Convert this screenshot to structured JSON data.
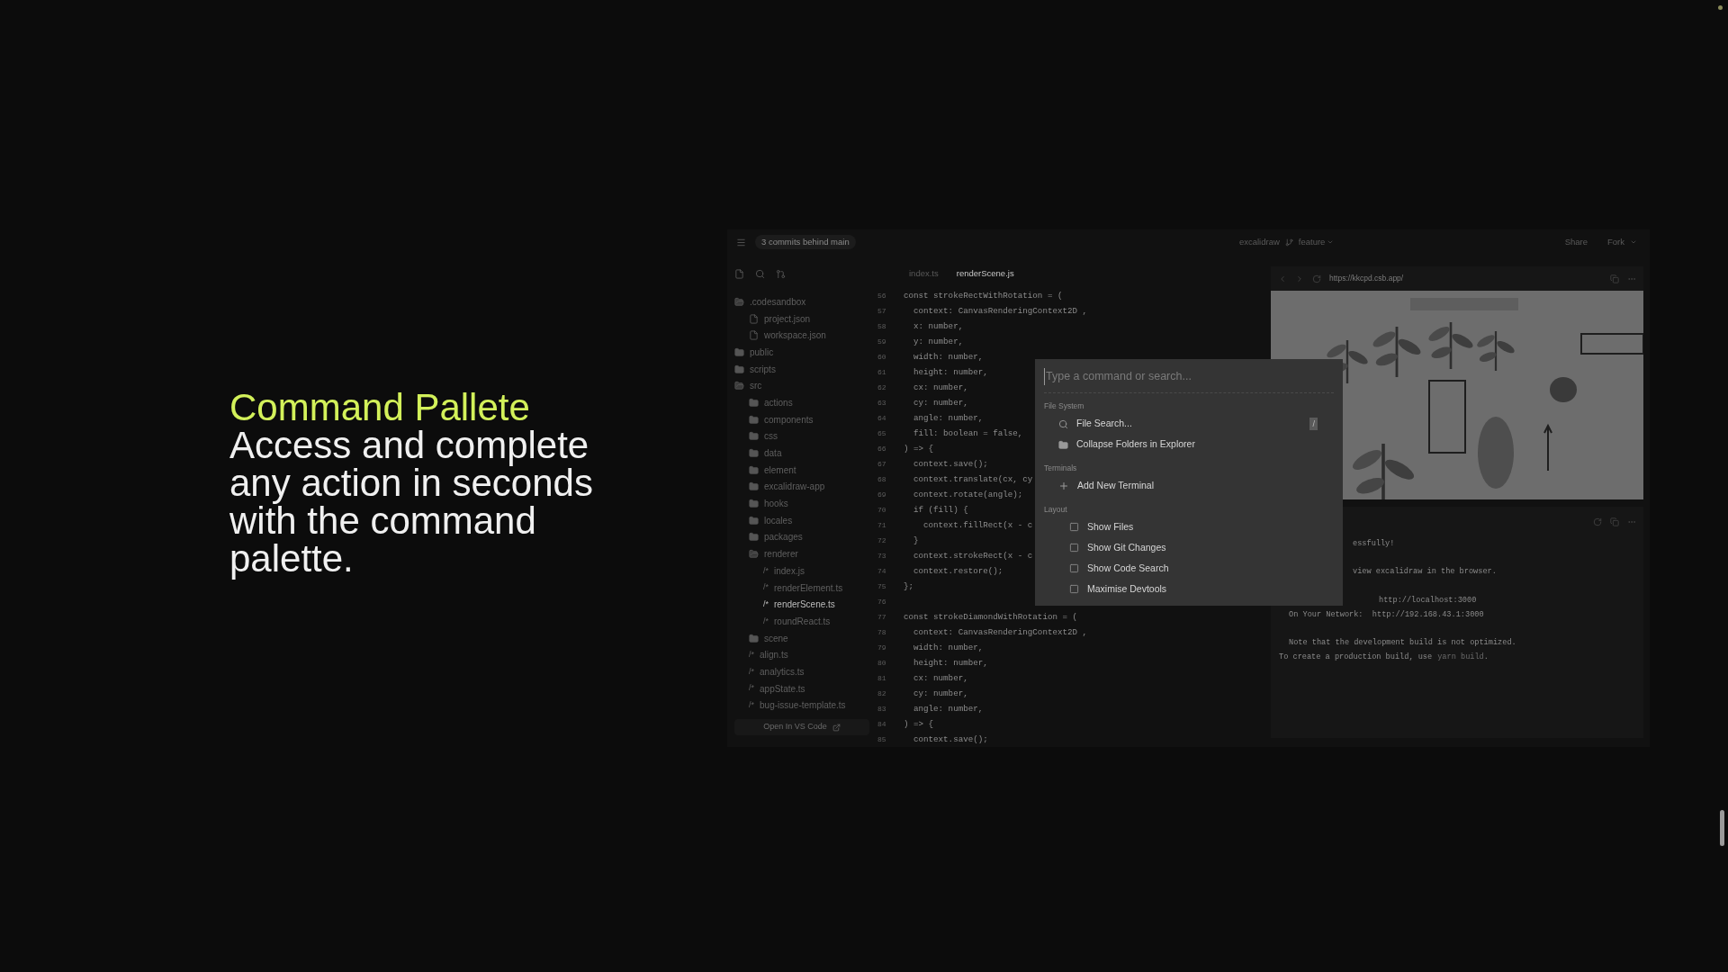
{
  "hero": {
    "title": "Command Pallete",
    "body": "Access and complete any action in seconds with the command palette."
  },
  "header": {
    "commits": "3 commits behind main",
    "project": "excalidraw",
    "branch": "feature",
    "share": "Share",
    "fork": "Fork"
  },
  "sidebar": {
    "tree": [
      {
        "name": ".codesandbox",
        "kind": "folder",
        "expanded": true,
        "selected": false,
        "children": [
          {
            "name": "project.json",
            "kind": "file",
            "selected": false
          },
          {
            "name": "workspace.json",
            "kind": "file",
            "selected": false
          }
        ]
      },
      {
        "name": "public",
        "kind": "folder",
        "expanded": false,
        "selected": false
      },
      {
        "name": "scripts",
        "kind": "folder",
        "expanded": false,
        "selected": false
      },
      {
        "name": "src",
        "kind": "folder",
        "expanded": true,
        "selected": false,
        "children": [
          {
            "name": "actions",
            "kind": "folder",
            "expanded": false,
            "selected": false
          },
          {
            "name": "components",
            "kind": "folder",
            "expanded": false,
            "selected": false
          },
          {
            "name": "css",
            "kind": "folder",
            "expanded": false,
            "selected": false
          },
          {
            "name": "data",
            "kind": "folder",
            "expanded": false,
            "selected": false
          },
          {
            "name": "element",
            "kind": "folder",
            "expanded": false,
            "selected": false
          },
          {
            "name": "excalidraw-app",
            "kind": "folder",
            "expanded": false,
            "selected": false
          },
          {
            "name": "hooks",
            "kind": "folder",
            "expanded": false,
            "selected": false
          },
          {
            "name": "locales",
            "kind": "folder",
            "expanded": false,
            "selected": false
          },
          {
            "name": "packages",
            "kind": "folder",
            "expanded": false,
            "selected": false
          },
          {
            "name": "renderer",
            "kind": "folder",
            "expanded": true,
            "selected": false,
            "children": [
              {
                "name": "index.js",
                "kind": "code",
                "glyph": "/*",
                "selected": false
              },
              {
                "name": "renderElement.ts",
                "kind": "code",
                "glyph": "/*",
                "selected": false
              },
              {
                "name": "renderScene.ts",
                "kind": "code",
                "glyph": "/*",
                "selected": true
              },
              {
                "name": "roundReact.ts",
                "kind": "code",
                "glyph": "/*",
                "selected": false
              }
            ]
          },
          {
            "name": "scene",
            "kind": "folder",
            "expanded": false,
            "selected": false
          },
          {
            "name": "align.ts",
            "kind": "code",
            "glyph": "/*",
            "selected": false
          },
          {
            "name": "analytics.ts",
            "kind": "code",
            "glyph": "/*",
            "selected": false
          },
          {
            "name": "appState.ts",
            "kind": "code",
            "glyph": "/*",
            "selected": false
          },
          {
            "name": "bug-issue-template.ts",
            "kind": "code",
            "glyph": "/*",
            "selected": false
          }
        ]
      }
    ],
    "open_button": "Open In VS Code"
  },
  "editor": {
    "tabs": [
      {
        "label": "index.ts",
        "selected": false
      },
      {
        "label": "renderScene.js",
        "selected": true
      }
    ],
    "lines": [
      {
        "number": "56",
        "code": "const strokeRectWithRotation = ("
      },
      {
        "number": "57",
        "code": "  context: CanvasRenderingContext2D ,"
      },
      {
        "number": "58",
        "code": "  x: number,"
      },
      {
        "number": "59",
        "code": "  y: number,"
      },
      {
        "number": "60",
        "code": "  width: number,"
      },
      {
        "number": "61",
        "code": "  height: number,"
      },
      {
        "number": "62",
        "code": "  cx: number,"
      },
      {
        "number": "63",
        "code": "  cy: number,"
      },
      {
        "number": "64",
        "code": "  angle: number,"
      },
      {
        "number": "65",
        "code": "  fill: boolean = false,"
      },
      {
        "number": "66",
        "code": ") => {"
      },
      {
        "number": "67",
        "code": "  context.save();"
      },
      {
        "number": "68",
        "code": "  context.translate(cx, cy"
      },
      {
        "number": "69",
        "code": "  context.rotate(angle);"
      },
      {
        "number": "70",
        "code": "  if (fill) {"
      },
      {
        "number": "71",
        "code": "    context.fillRect(x - c"
      },
      {
        "number": "72",
        "code": "  }"
      },
      {
        "number": "73",
        "code": "  context.strokeRect(x - c"
      },
      {
        "number": "74",
        "code": "  context.restore();"
      },
      {
        "number": "75",
        "code": "};"
      },
      {
        "number": "76"
      },
      {
        "number": "77",
        "code": "const strokeDiamondWithRotation = ("
      },
      {
        "number": "78",
        "code": "  context: CanvasRenderingContext2D ,"
      },
      {
        "number": "79",
        "code": "  width: number,"
      },
      {
        "number": "80",
        "code": "  height: number,"
      },
      {
        "number": "81",
        "code": "  cx: number,"
      },
      {
        "number": "82",
        "code": "  cy: number,"
      },
      {
        "number": "83",
        "code": "  angle: number,"
      },
      {
        "number": "84",
        "code": ") => {"
      },
      {
        "number": "85",
        "code": "  context.save();"
      }
    ]
  },
  "preview": {
    "url": "https://kkcpd.csb.app/"
  },
  "terminal": {
    "lines": [
      {
        "kind": "tail",
        "text": "essfully!"
      },
      {
        "kind": "blank"
      },
      {
        "kind": "tail",
        "text": "view excalidraw in the browser."
      },
      {
        "kind": "blank"
      },
      {
        "kind": "url",
        "text": "http://localhost:3000"
      },
      {
        "kind": "plain",
        "text": "On Your Network:  http://192.168.43.1:3000"
      },
      {
        "kind": "blank"
      },
      {
        "kind": "plain",
        "text": "Note that the development build is not optimized."
      },
      {
        "kind": "command",
        "text": "To create a production build, use",
        "command": "yarn build",
        "after": "."
      }
    ]
  },
  "palette": {
    "placeholder": "Type a command or search...",
    "sections": [
      {
        "title": "File System",
        "items": [
          {
            "kind": "search",
            "label": "File Search...",
            "shortcut": "/"
          },
          {
            "kind": "folder",
            "label": "Collapse Folders in Explorer"
          }
        ]
      },
      {
        "title": "Terminals",
        "items": [
          {
            "kind": "add",
            "label": "Add New Terminal"
          }
        ]
      },
      {
        "title": "Layout",
        "items": [
          {
            "kind": "toggle",
            "label": "Show Files",
            "checked": false
          },
          {
            "kind": "toggle",
            "label": "Show Git Changes",
            "checked": false
          },
          {
            "kind": "toggle",
            "label": "Show Code Search",
            "checked": false
          },
          {
            "kind": "toggle",
            "label": "Maximise Devtools",
            "checked": false
          }
        ]
      }
    ]
  }
}
